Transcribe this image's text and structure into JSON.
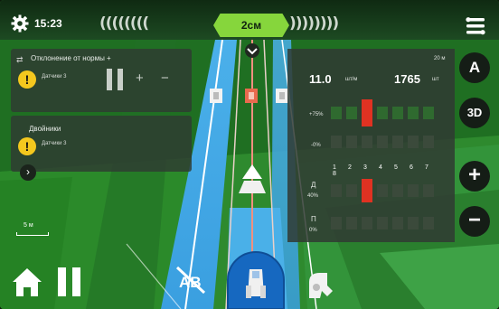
{
  "status": {
    "time": "15:23",
    "guidance_offset": "2см",
    "chevrons_left": "((((((((",
    "chevrons_right": "))))))))"
  },
  "alerts": [
    {
      "title": "Отклонение от нормы +",
      "subtitle": "Датчики 3"
    },
    {
      "title": "Двойники",
      "subtitle": "Датчики 3"
    }
  ],
  "controls": {
    "plus": "+",
    "minus": "−",
    "expand": "›",
    "zoom_in": "+",
    "zoom_out": "−",
    "view_2d": "A",
    "view_3d": "3D"
  },
  "scale": {
    "label": "5 м"
  },
  "stats": {
    "speed_label": "20 м",
    "rate_value": "11.0",
    "rate_unit": "шт/м",
    "count_value": "1765",
    "count_unit": "шт",
    "row1_label": "+75%",
    "row2_label": "-0%",
    "row3_label": "Д",
    "row3_sub": "40%",
    "row4_label": "П",
    "row4_sub": "0%",
    "row_numbers": [
      "1",
      "2",
      "3",
      "4",
      "5",
      "6",
      "7",
      "8"
    ],
    "active_row": 3
  },
  "colors": {
    "offset_badge": "#86d63c",
    "guidance_line": "#4aa8e6",
    "warning": "#f4c81e",
    "active_cell": "#e03222",
    "cell": "#2f6a2f"
  },
  "icons": {
    "settings": "gear-icon",
    "menu": "menu-icon",
    "home": "home-icon",
    "pause": "pause-icon",
    "ab_line": "ab-line-off-icon",
    "tractor": "tractor-icon",
    "implement": "implement-icon",
    "warning": "warning-icon"
  }
}
